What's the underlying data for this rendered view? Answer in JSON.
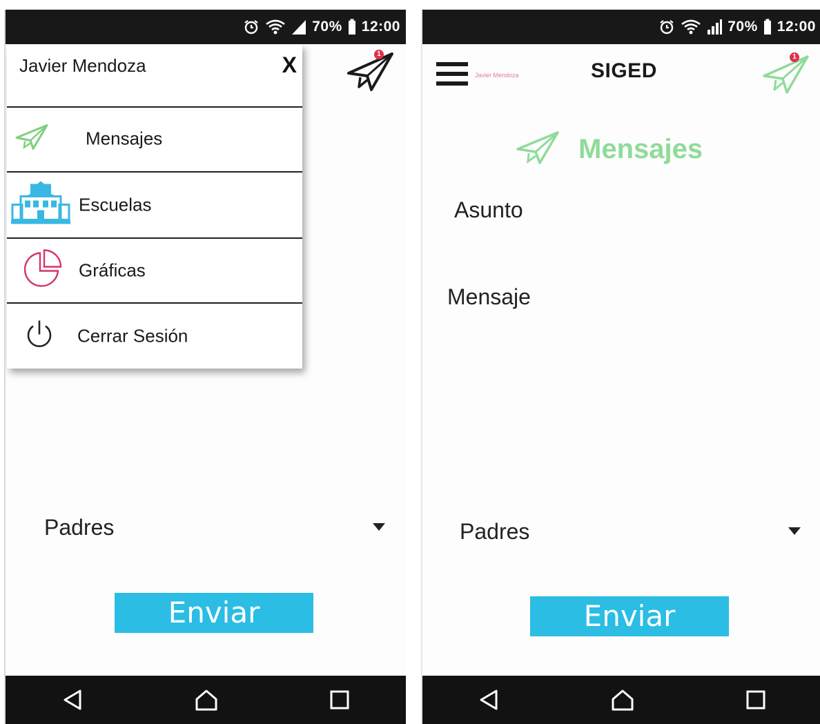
{
  "status_bar": {
    "battery": "70%",
    "time": "12:00"
  },
  "left_screen": {
    "drawer": {
      "user_name": "Javier Mendoza",
      "close_label": "X",
      "items": [
        {
          "label": "Mensajes",
          "icon": "paper-plane-icon"
        },
        {
          "label": "Escuelas",
          "icon": "school-building-icon"
        },
        {
          "label": "Gráficas",
          "icon": "pie-chart-icon"
        },
        {
          "label": "Cerrar Sesión",
          "icon": "power-icon"
        }
      ]
    },
    "notification_badge": "1",
    "recipient_select": {
      "selected": "Padres"
    },
    "send_button": "Enviar"
  },
  "right_screen": {
    "header": {
      "app_title": "SIGED",
      "user_name": "Javier Mendoza"
    },
    "notification_badge": "1",
    "section_title": "Mensajes",
    "subject_label": "Asunto",
    "message_label": "Mensaje",
    "recipient_select": {
      "selected": "Padres"
    },
    "send_button": "Enviar"
  },
  "colors": {
    "accent_blue": "#2bbde3",
    "accent_green": "#8fdb9a",
    "accent_pink": "#d6336c",
    "badge_red": "#e0304a"
  }
}
